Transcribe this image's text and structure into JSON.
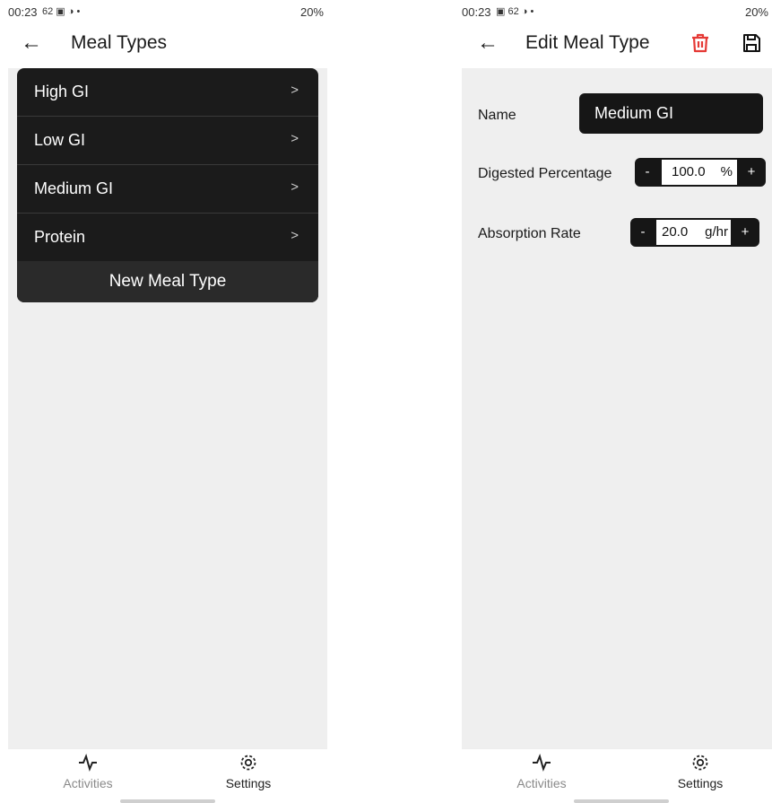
{
  "left": {
    "status": {
      "time": "00:23",
      "icons": "62 ▣ ◑ •",
      "right": "20%"
    },
    "title": "Meal Types",
    "items": [
      {
        "label": "High GI"
      },
      {
        "label": "Low GI"
      },
      {
        "label": "Medium GI"
      },
      {
        "label": "Protein"
      }
    ],
    "chevron": ">",
    "new_button": "New Meal Type",
    "nav": {
      "activities": "Activities",
      "settings": "Settings"
    }
  },
  "right": {
    "status": {
      "time": "00:23",
      "icons": "▣ 62 ◑ •",
      "right": "20%"
    },
    "title": "Edit Meal Type",
    "name_label": "Name",
    "name_value": "Medium GI",
    "digested_label": "Digested Percentage",
    "digested_value": "100.0",
    "digested_unit": "%",
    "absorption_label": "Absorption Rate",
    "absorption_value": "20.0",
    "absorption_unit": "g/hr",
    "minus": "-",
    "plus": "+",
    "nav": {
      "activities": "Activities",
      "settings": "Settings"
    }
  },
  "colors": {
    "delete": "#e53935",
    "card": "#1b1b1b",
    "background": "#efefef"
  }
}
